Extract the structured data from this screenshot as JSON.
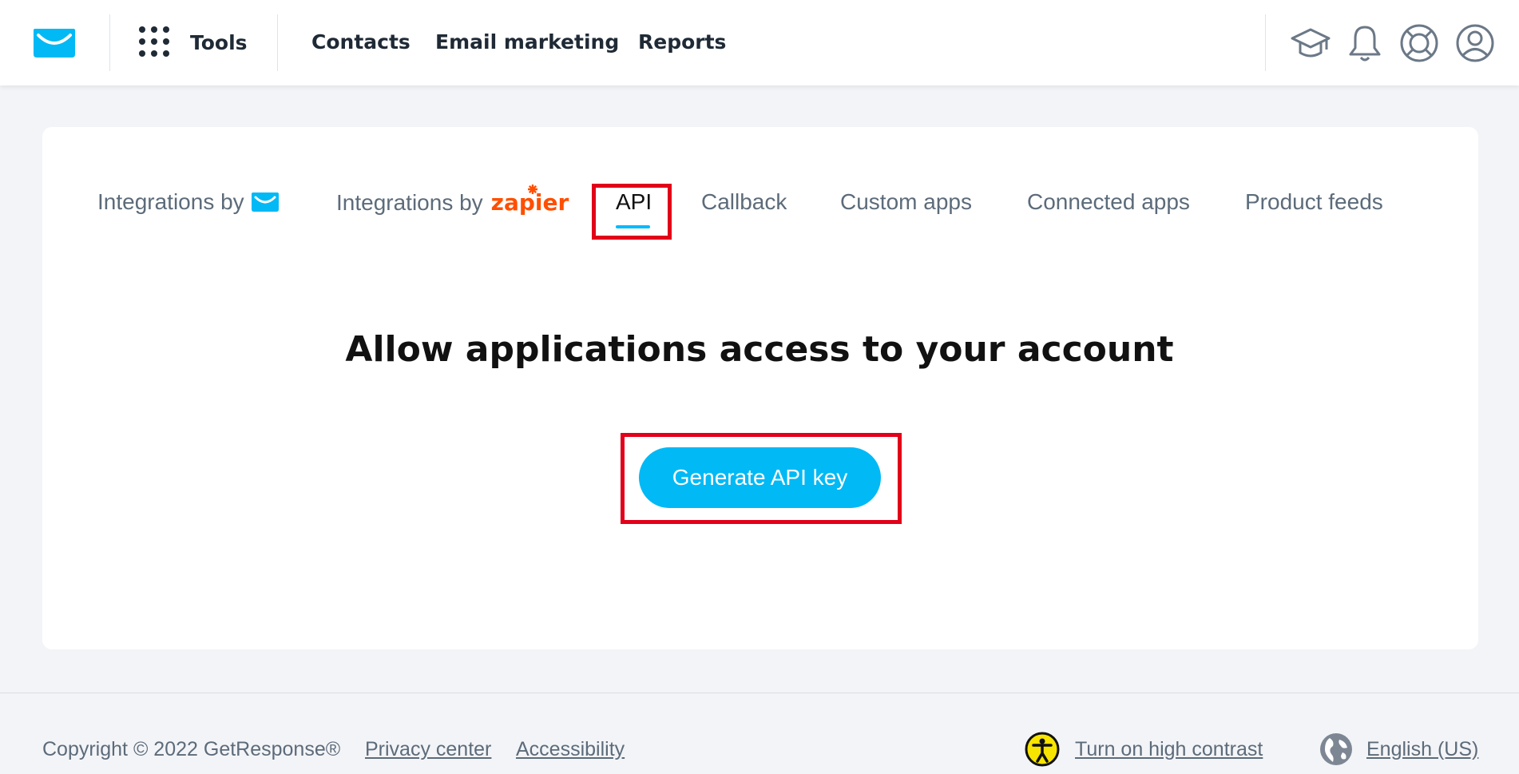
{
  "header": {
    "tools_label": "Tools",
    "nav": {
      "contacts": "Contacts",
      "email_marketing": "Email marketing",
      "reports": "Reports"
    },
    "icons": [
      "getresponse-logo-icon",
      "apps-grid-icon",
      "graduation-cap-icon",
      "bell-icon",
      "lifebuoy-icon",
      "user-account-icon"
    ]
  },
  "tabs": {
    "integrations_gr": "Integrations by",
    "integrations_zapier": "Integrations by",
    "zapier_logo": "zapier",
    "api": "API",
    "callback": "Callback",
    "custom_apps": "Custom apps",
    "connected_apps": "Connected apps",
    "product_feeds": "Product feeds"
  },
  "main": {
    "heading": "Allow applications access to your account",
    "cta_label": "Generate API key"
  },
  "footer": {
    "copyright": "Copyright © 2022 GetResponse®",
    "privacy": "Privacy center",
    "accessibility": "Accessibility",
    "high_contrast": "Turn on high contrast",
    "language": "English (US)"
  },
  "colors": {
    "accent": "#00b9f5",
    "highlight": "#e2001a",
    "zapier": "#ff4f00"
  }
}
